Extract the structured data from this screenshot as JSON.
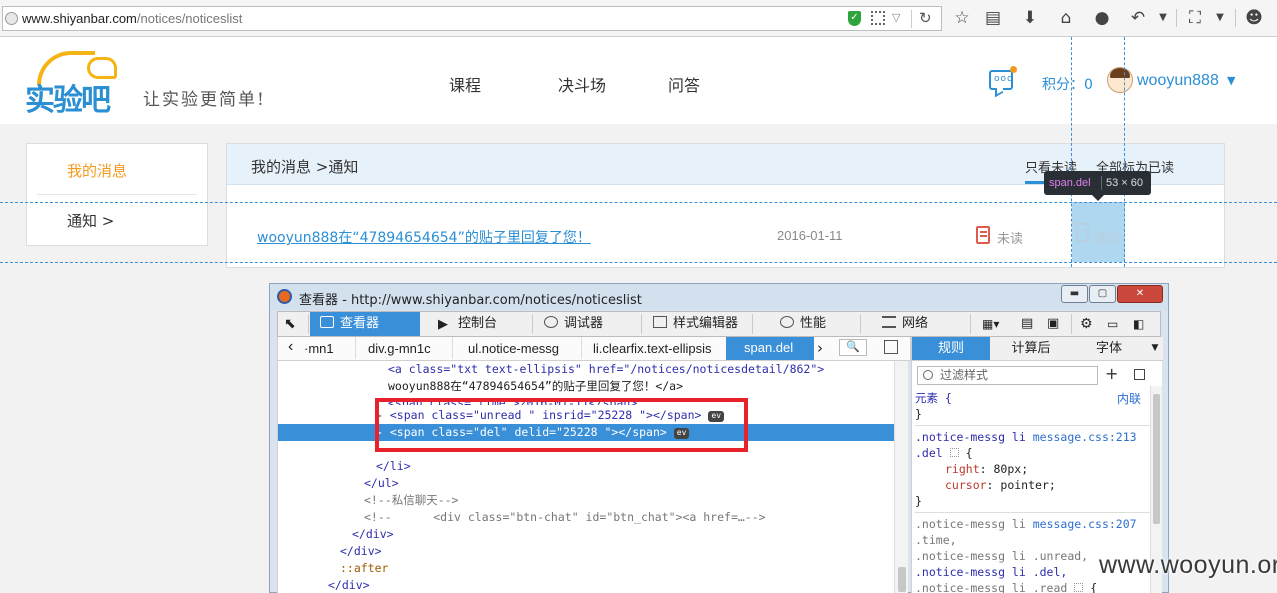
{
  "browser": {
    "url_host": "www.shiyanbar.com",
    "url_path": "/notices/noticeslist"
  },
  "site": {
    "logo_text": "实验吧",
    "slogan": "让实验更简单!",
    "nav": [
      "课程",
      "决斗场",
      "问答"
    ],
    "score_label": "积分：0",
    "username": "wooyun888"
  },
  "sidebar": {
    "items": [
      {
        "label": "我的消息"
      },
      {
        "label": "通知 >"
      }
    ]
  },
  "main": {
    "breadcrumb": "我的消息 >通知",
    "filter_unread": "只看未读",
    "mark_all_read": "全部标为已读",
    "notice": {
      "title": "wooyun888在“47894654654”的贴子里回复了您！",
      "date": "2016-01-11",
      "unread_label": "未读",
      "delete_label": "删除"
    }
  },
  "tooltip": {
    "tag": "span.del",
    "dims": "53 × 60"
  },
  "devtools": {
    "window_title": "查看器 - http://www.shiyanbar.com/notices/noticeslist",
    "tabs": [
      "查看器",
      "控制台",
      "调试器",
      "样式编辑器",
      "性能",
      "网络"
    ],
    "breadcrumbs": [
      "‹",
      "·mn1",
      "div.g-mn1c",
      "ul.notice-messg",
      "li.clearfix.text-ellipsis",
      "span.del"
    ],
    "markup_lines": [
      "<a class=\"txt text-ellipsis\" href=\"/notices/noticesdetail/862\">",
      "wooyun888在“47894654654”的贴子里回复了您！</a>",
      "<span class=\"time\">2016-01-11</span>",
      "<span class=\"unread \" insrid=\"25228 \"></span>",
      "<span class=\"del\" delid=\"25228 \"></span>",
      "</li>",
      "</ul>",
      "<!--私信聊天-->",
      "<!--      <div class=\"btn-chat\" id=\"btn_chat\"><a href=…-->",
      "</div>",
      "</div>",
      "::after",
      "</div>"
    ],
    "ev_badge": "ev",
    "side_tabs": [
      "规则",
      "计算后",
      "字体"
    ],
    "filter_placeholder": "过滤样式",
    "rules": {
      "element_label": "元素 {",
      "inline_label": "内联",
      "close_brace": "}",
      "rule1_selector": ".notice-messg li",
      "rule1_file": "message.css:213",
      "rule1_selector2": ".del",
      "rule1_prop1": "right",
      "rule1_val1": "80px",
      "rule1_prop2": "cursor",
      "rule1_val2": "pointer",
      "rule2_selector": ".notice-messg li",
      "rule2_file": "message.css:207",
      "rule2_lines": [
        ".time,",
        ".notice-messg li .unread,",
        ".notice-messg li .del,",
        ".notice-messg li .read"
      ]
    }
  },
  "watermark": "www.wooyun.org"
}
